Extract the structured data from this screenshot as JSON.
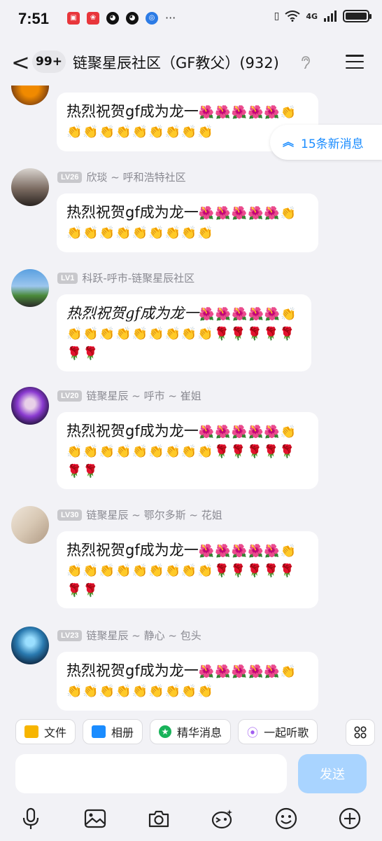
{
  "status_bar": {
    "time": "7:51",
    "network": "4G",
    "more": "···"
  },
  "header": {
    "back_glyph": "<",
    "unread_badge": "99+",
    "title": "链聚星辰社区（GF教父）(932)",
    "ear_icon": "ear-icon"
  },
  "new_messages": {
    "label": "15条新消息"
  },
  "messages": [
    {
      "level": "",
      "sender": "",
      "text": "热烈祝贺gf成为龙一",
      "emoji": "🌺🌺🌺🌺🌺👏👏👏👏👏👏👏👏👏👏"
    },
    {
      "level": "LV26",
      "sender": "欣琰 ~ 呼和浩特社区",
      "text": "热烈祝贺gf成为龙一",
      "emoji": "🌺🌺🌺🌺🌺👏👏👏👏👏👏👏👏👏👏"
    },
    {
      "level": "LV1",
      "sender": "科跃-呼市-链聚星辰社区",
      "text": "热烈祝贺gf成为龙一",
      "emoji": "🌺🌺🌺🌺🌺👏👏👏👏👏👏👏👏👏👏🌹🌹🌹🌹🌹🌹🌹"
    },
    {
      "level": "LV20",
      "sender": "链聚星辰 ~ 呼市 ~ 崔姐",
      "text": "热烈祝贺gf成为龙一",
      "emoji": "🌺🌺🌺🌺🌺👏👏👏👏👏👏👏👏👏👏🌹🌹🌹🌹🌹🌹🌹"
    },
    {
      "level": "LV30",
      "sender": "链聚星辰 ~ 鄂尔多斯 ~ 花姐",
      "text": "热烈祝贺gf成为龙一",
      "emoji": "🌺🌺🌺🌺🌺👏👏👏👏👏👏👏👏👏👏🌹🌹🌹🌹🌹🌹🌹"
    },
    {
      "level": "LV23",
      "sender": "链聚星辰 ~ 静心 ~ 包头",
      "text": "热烈祝贺gf成为龙一",
      "emoji": "🌺🌺🌺🌺🌺👏👏👏👏👏👏👏👏👏👏"
    }
  ],
  "quick_actions": [
    {
      "label": "文件",
      "icon": "folder-icon",
      "color": "#f7b500"
    },
    {
      "label": "相册",
      "icon": "photo-icon",
      "color": "#1a8cff"
    },
    {
      "label": "精华消息",
      "icon": "star-icon",
      "color": "#18b35a"
    },
    {
      "label": "一起听歌",
      "icon": "earbuds-icon",
      "color": "#a05cf0"
    }
  ],
  "composer": {
    "send_label": "发送",
    "send_color": "#a9d4ff"
  },
  "bottom_icons": [
    "microphone-icon",
    "image-icon",
    "camera-icon",
    "sticker-icon",
    "emoji-icon",
    "plus-icon"
  ],
  "colors": {
    "accent": "#1a8cff",
    "level_badge": "#c8c8cc"
  }
}
